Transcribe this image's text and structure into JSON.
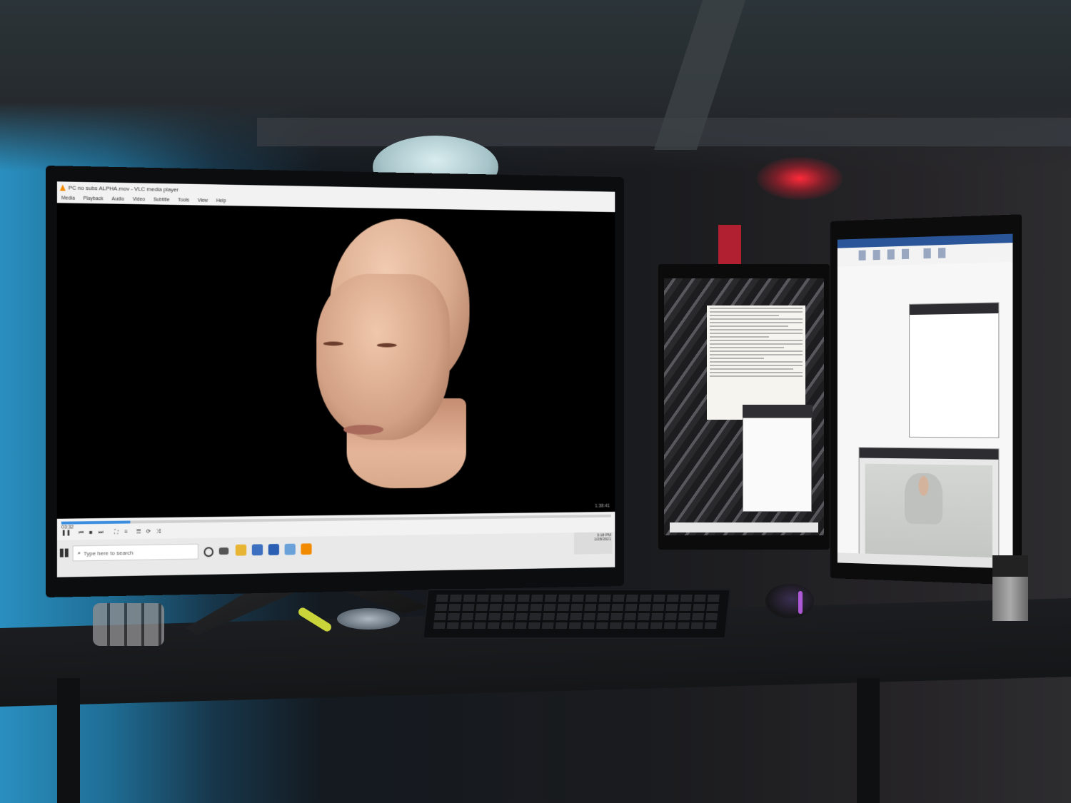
{
  "vlc": {
    "window_title": "PC no subs ALPHA.mov - VLC media player",
    "menu": [
      "Media",
      "Playback",
      "Audio",
      "Video",
      "Subtitle",
      "Tools",
      "View",
      "Help"
    ],
    "elapsed_time": "03:32",
    "remaining_time": "1:38:41",
    "playback_progress": 0.12
  },
  "taskbar": {
    "search_placeholder": "Type here to search",
    "clock_time": "3:18 PM",
    "clock_date": "1/28/2021"
  },
  "colors": {
    "vlc_accent": "#f28a00",
    "seek_fill": "#3b8de0",
    "word_blue": "#2a5699"
  }
}
